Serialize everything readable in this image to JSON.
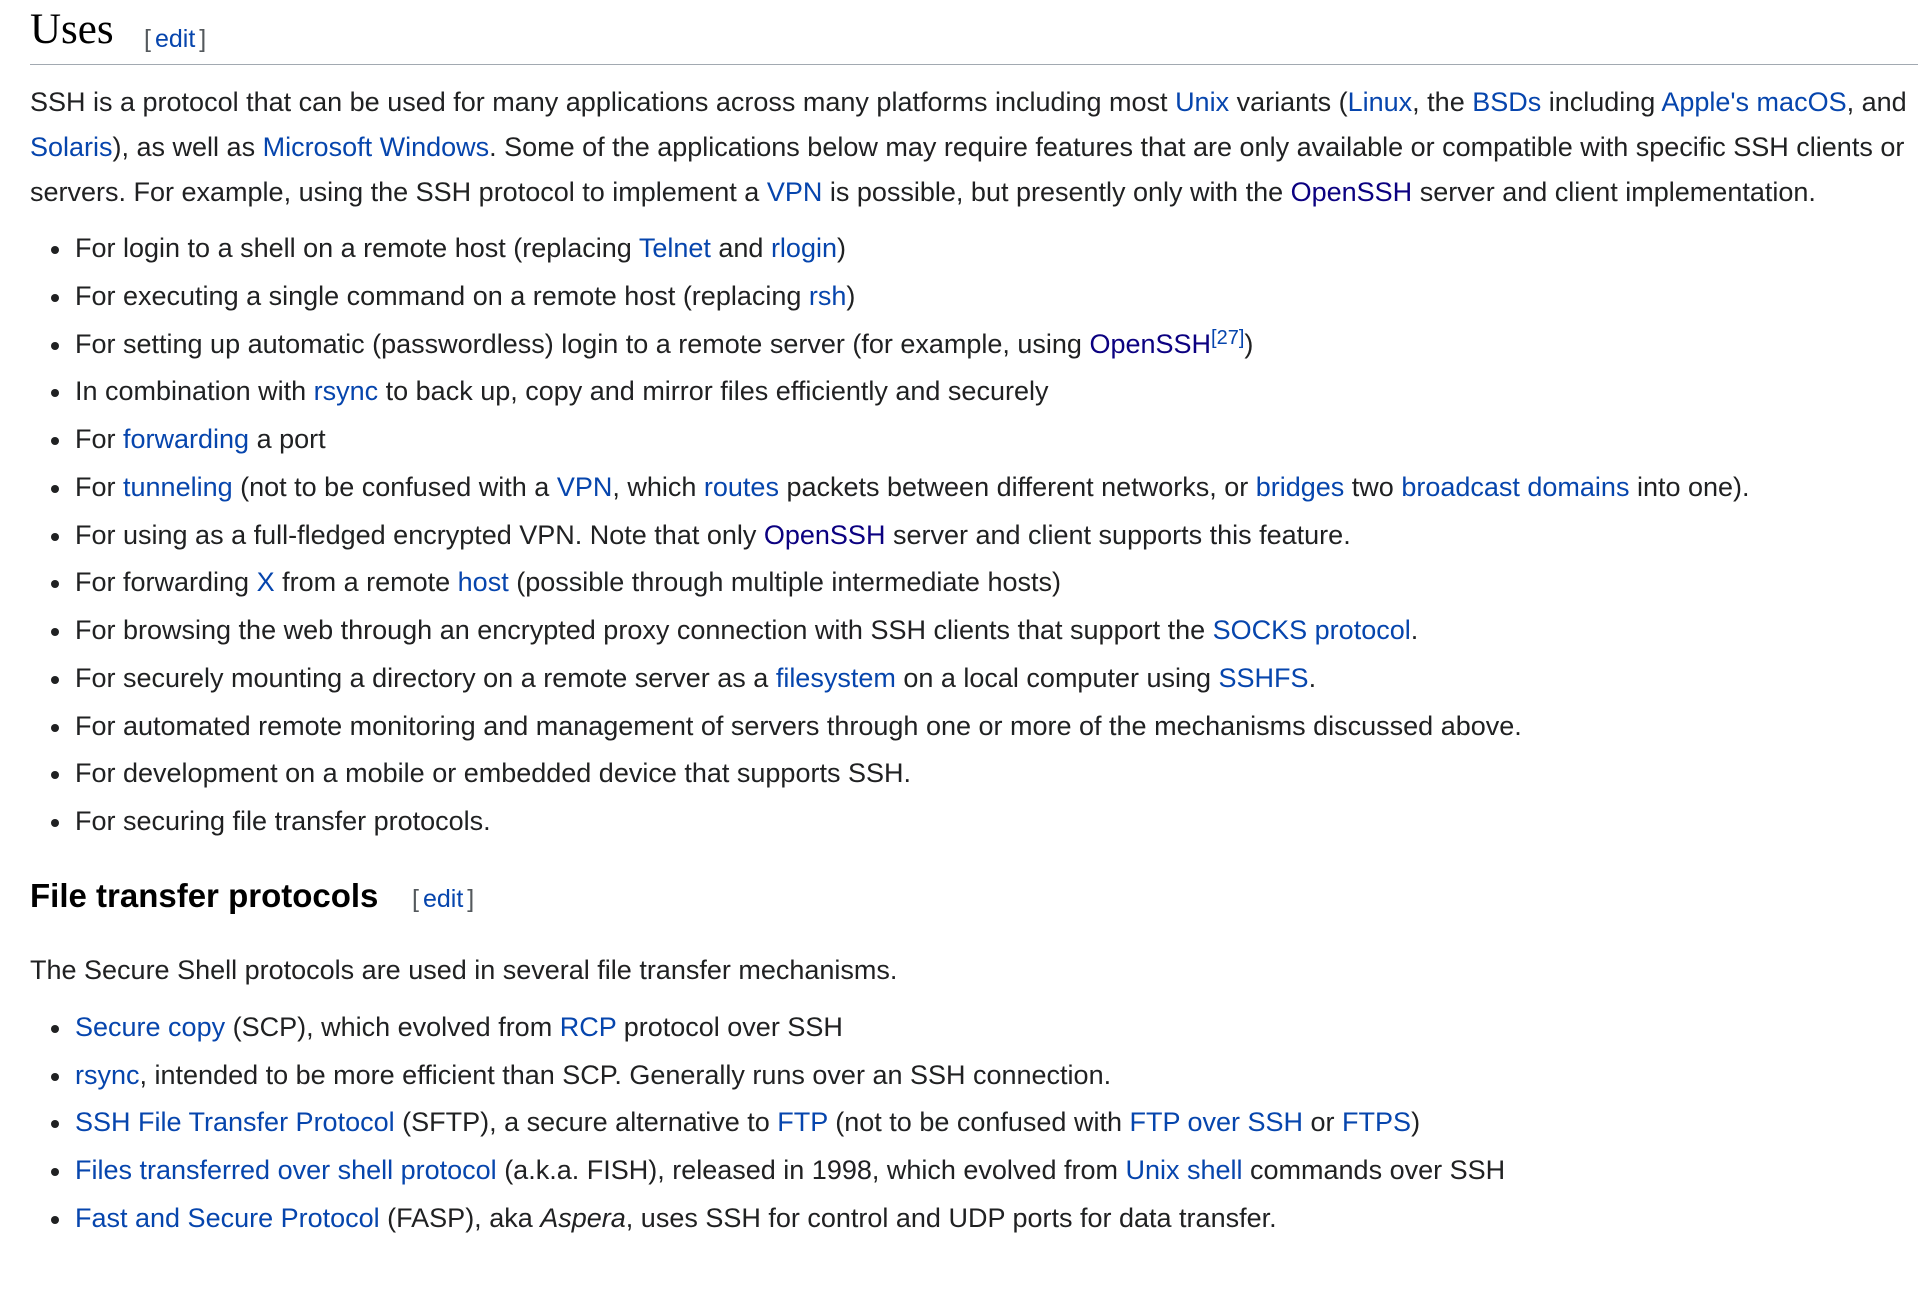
{
  "uses": {
    "heading": "Uses",
    "edit": "edit",
    "intro": [
      {
        "t": "SSH is a protocol that can be used for many applications across many platforms including most "
      },
      {
        "a": "Unix"
      },
      {
        "t": " variants ("
      },
      {
        "a": "Linux"
      },
      {
        "t": ", the "
      },
      {
        "a": "BSDs"
      },
      {
        "t": " including "
      },
      {
        "a": "Apple's macOS"
      },
      {
        "t": ", and "
      },
      {
        "a": "Solaris"
      },
      {
        "t": "), as well as "
      },
      {
        "a": "Microsoft Windows"
      },
      {
        "t": ". Some of the applications below may require features that are only available or compatible with specific SSH clients or servers. For example, using the SSH protocol to implement a "
      },
      {
        "a": "VPN"
      },
      {
        "t": " is possible, but presently only with the "
      },
      {
        "v": "OpenSSH"
      },
      {
        "t": " server and client implementation."
      }
    ],
    "items": [
      [
        {
          "t": "For login to a shell on a remote host (replacing "
        },
        {
          "a": "Telnet"
        },
        {
          "t": " and "
        },
        {
          "a": "rlogin"
        },
        {
          "t": ")"
        }
      ],
      [
        {
          "t": "For executing a single command on a remote host (replacing "
        },
        {
          "a": "rsh"
        },
        {
          "t": ")"
        }
      ],
      [
        {
          "t": "For setting up automatic (passwordless) login to a remote server (for example, using "
        },
        {
          "v": "OpenSSH"
        },
        {
          "sup": "[27]"
        },
        {
          "t": ")"
        }
      ],
      [
        {
          "t": "In combination with "
        },
        {
          "a": "rsync"
        },
        {
          "t": " to back up, copy and mirror files efficiently and securely"
        }
      ],
      [
        {
          "t": "For "
        },
        {
          "a": "forwarding"
        },
        {
          "t": " a port"
        }
      ],
      [
        {
          "t": "For "
        },
        {
          "a": "tunneling"
        },
        {
          "t": " (not to be confused with a "
        },
        {
          "a": "VPN"
        },
        {
          "t": ", which "
        },
        {
          "a": "routes"
        },
        {
          "t": " packets between different networks, or "
        },
        {
          "a": "bridges"
        },
        {
          "t": " two "
        },
        {
          "a": "broadcast domains"
        },
        {
          "t": " into one)."
        }
      ],
      [
        {
          "t": "For using as a full-fledged encrypted VPN. Note that only "
        },
        {
          "v": "OpenSSH"
        },
        {
          "t": " server and client supports this feature."
        }
      ],
      [
        {
          "t": "For forwarding "
        },
        {
          "a": "X"
        },
        {
          "t": " from a remote "
        },
        {
          "a": "host"
        },
        {
          "t": " (possible through multiple intermediate hosts)"
        }
      ],
      [
        {
          "t": "For browsing the web through an encrypted proxy connection with SSH clients that support the "
        },
        {
          "a": "SOCKS protocol"
        },
        {
          "t": "."
        }
      ],
      [
        {
          "t": "For securely mounting a directory on a remote server as a "
        },
        {
          "a": "filesystem"
        },
        {
          "t": " on a local computer using "
        },
        {
          "a": "SSHFS"
        },
        {
          "t": "."
        }
      ],
      [
        {
          "t": "For automated remote monitoring and management of servers through one or more of the mechanisms discussed above."
        }
      ],
      [
        {
          "t": "For development on a mobile or embedded device that supports SSH."
        }
      ],
      [
        {
          "t": "For securing file transfer protocols."
        }
      ]
    ]
  },
  "ftp": {
    "heading": "File transfer protocols",
    "edit": "edit",
    "intro": [
      {
        "t": "The Secure Shell protocols are used in several file transfer mechanisms."
      }
    ],
    "items": [
      [
        {
          "a": "Secure copy"
        },
        {
          "t": " (SCP), which evolved from "
        },
        {
          "a": "RCP"
        },
        {
          "t": " protocol over SSH"
        }
      ],
      [
        {
          "a": "rsync"
        },
        {
          "t": ", intended to be more efficient than SCP. Generally runs over an SSH connection."
        }
      ],
      [
        {
          "a": "SSH File Transfer Protocol"
        },
        {
          "t": " (SFTP), a secure alternative to "
        },
        {
          "a": "FTP"
        },
        {
          "t": " (not to be confused with "
        },
        {
          "a": "FTP over SSH"
        },
        {
          "t": " or "
        },
        {
          "a": "FTPS"
        },
        {
          "t": ")"
        }
      ],
      [
        {
          "a": "Files transferred over shell protocol"
        },
        {
          "t": " (a.k.a. FISH), released in 1998, which evolved from "
        },
        {
          "a": "Unix shell"
        },
        {
          "t": " commands over SSH"
        }
      ],
      [
        {
          "a": "Fast and Secure Protocol"
        },
        {
          "t": " (FASP), aka "
        },
        {
          "i": "Aspera"
        },
        {
          "t": ", uses SSH for control and UDP ports for data transfer."
        }
      ]
    ]
  }
}
